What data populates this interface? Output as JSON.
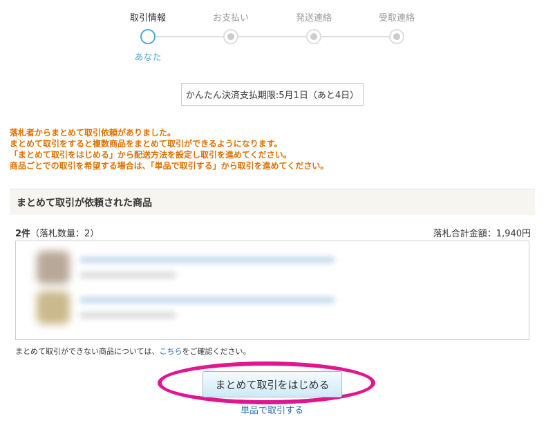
{
  "steps": [
    {
      "label": "取引情報",
      "active": true
    },
    {
      "label": "お支払い",
      "active": false
    },
    {
      "label": "発送連絡",
      "active": false
    },
    {
      "label": "受取連絡",
      "active": false
    }
  ],
  "current_step_marker": "あなた",
  "deadline": "かんたん決済支払期限:5月1日（あと4日）",
  "notice": {
    "line1": "落札者からまとめて取引依頼がありました。",
    "line2": "まとめて取引をすると複数商品をまとめて取引ができるようになります。",
    "line3": "「まとめて取引をはじめる」から配送方法を設定し取引を進めてください。",
    "line4": "商品ごとでの取引を希望する場合は、「単品で取引する」から取引を進めてください。"
  },
  "section_title": "まとめて取引が依頼された商品",
  "count": {
    "items": "2件",
    "quantity": "（落札数量：2）",
    "total": "落札合計金額：1,940円"
  },
  "note": {
    "prefix": "まとめて取引ができない商品については、",
    "link": "こちら",
    "suffix": "をご確認ください。"
  },
  "buttons": {
    "start": "まとめて取引をはじめる",
    "single": "単品で取引する"
  },
  "colors": {
    "accent": "#4aa8d8",
    "notice": "#e07000",
    "link": "#2a6fb5",
    "highlight": "#e0158f"
  }
}
